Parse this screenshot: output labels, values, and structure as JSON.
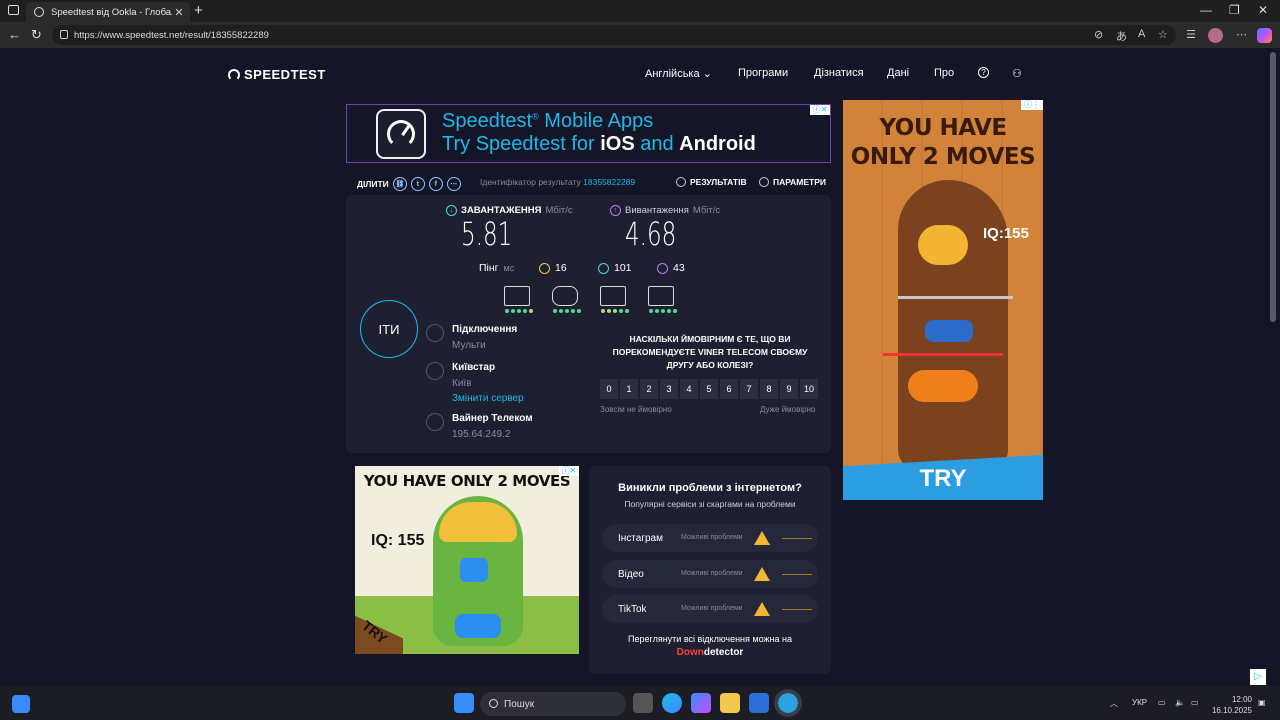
{
  "browser": {
    "tab_title": "Speedtest від Ookla - Глобальни",
    "url": "https://www.speedtest.net/result/18355822289"
  },
  "header": {
    "logo": "SPEEDTEST",
    "nav": [
      "Англійська",
      "Програми",
      "Дізнатися",
      "Дані",
      "Про"
    ]
  },
  "top_ad": {
    "line1_a": "Speedtest",
    "line1_b": "Mobile Apps",
    "line2_a": "Try Speedtest for",
    "line2_b": "iOS",
    "line2_c": "and",
    "line2_d": "Android"
  },
  "share_bar": {
    "share_label": "ДІЛИТИ",
    "result_id_label": "Ідентифікатор результату",
    "result_id": "18355822289",
    "results_link": "РЕЗУЛЬТАТІВ",
    "settings_link": "ПАРАМЕТРИ"
  },
  "result": {
    "download_label": "ЗАВАНТАЖЕННЯ",
    "download_unit": "Мбіт/с",
    "download_value": "5.81",
    "upload_label": "Вивантаження",
    "upload_unit": "Мбіт/с",
    "upload_value": "4.68",
    "ping_label": "Пінг",
    "ping_unit": "мс",
    "ping_idle": "16",
    "ping_down": "101",
    "ping_up": "43",
    "go_label": "ІТИ",
    "connection_title": "Підключення",
    "connection_value": "Мульти",
    "isp_title": "Київстар",
    "isp_city": "Київ",
    "change_server": "Змінити сервер",
    "host_title": "Вайнер Телеком",
    "host_ip": "195.64.249.2",
    "question": "НАСКІЛЬКИ ЙМОВІРНИМ Є ТЕ, ЩО ВИ ПОРЕКОМЕНДУЄТЕ VINER TELECOM СВОЄМУ ДРУГУ АБО КОЛЕЗІ?",
    "scale": [
      "0",
      "1",
      "2",
      "3",
      "4",
      "5",
      "6",
      "7",
      "8",
      "9",
      "10"
    ],
    "scale_low": "Зовсім не ймовірно",
    "scale_high": "Дуже ймовірно"
  },
  "right_ad": {
    "headline_1": "YOU HAVE",
    "headline_2": "ONLY 2 MOVES",
    "iq": "IQ:155",
    "cta": "TRY"
  },
  "bottom_ad": {
    "headline": "YOU HAVE ONLY 2 MOVES",
    "iq": "IQ: 155",
    "cta": "TRY"
  },
  "issues": {
    "title": "Виникли проблеми з інтернетом?",
    "subtitle": "Популярні сервіси зі скаргами на проблеми",
    "rows": [
      {
        "name": "Інстаграм",
        "status": "Можливі проблеми"
      },
      {
        "name": "Відео",
        "status": "Можливі проблеми"
      },
      {
        "name": "TikTok",
        "status": "Можливі проблеми"
      }
    ],
    "footer": "Переглянути всі відключення можна на",
    "brand_a": "Down",
    "brand_b": "detector"
  },
  "taskbar": {
    "search_placeholder": "Пошук",
    "lang": "УКР",
    "time": "12:00",
    "date": "16.10.2025"
  }
}
